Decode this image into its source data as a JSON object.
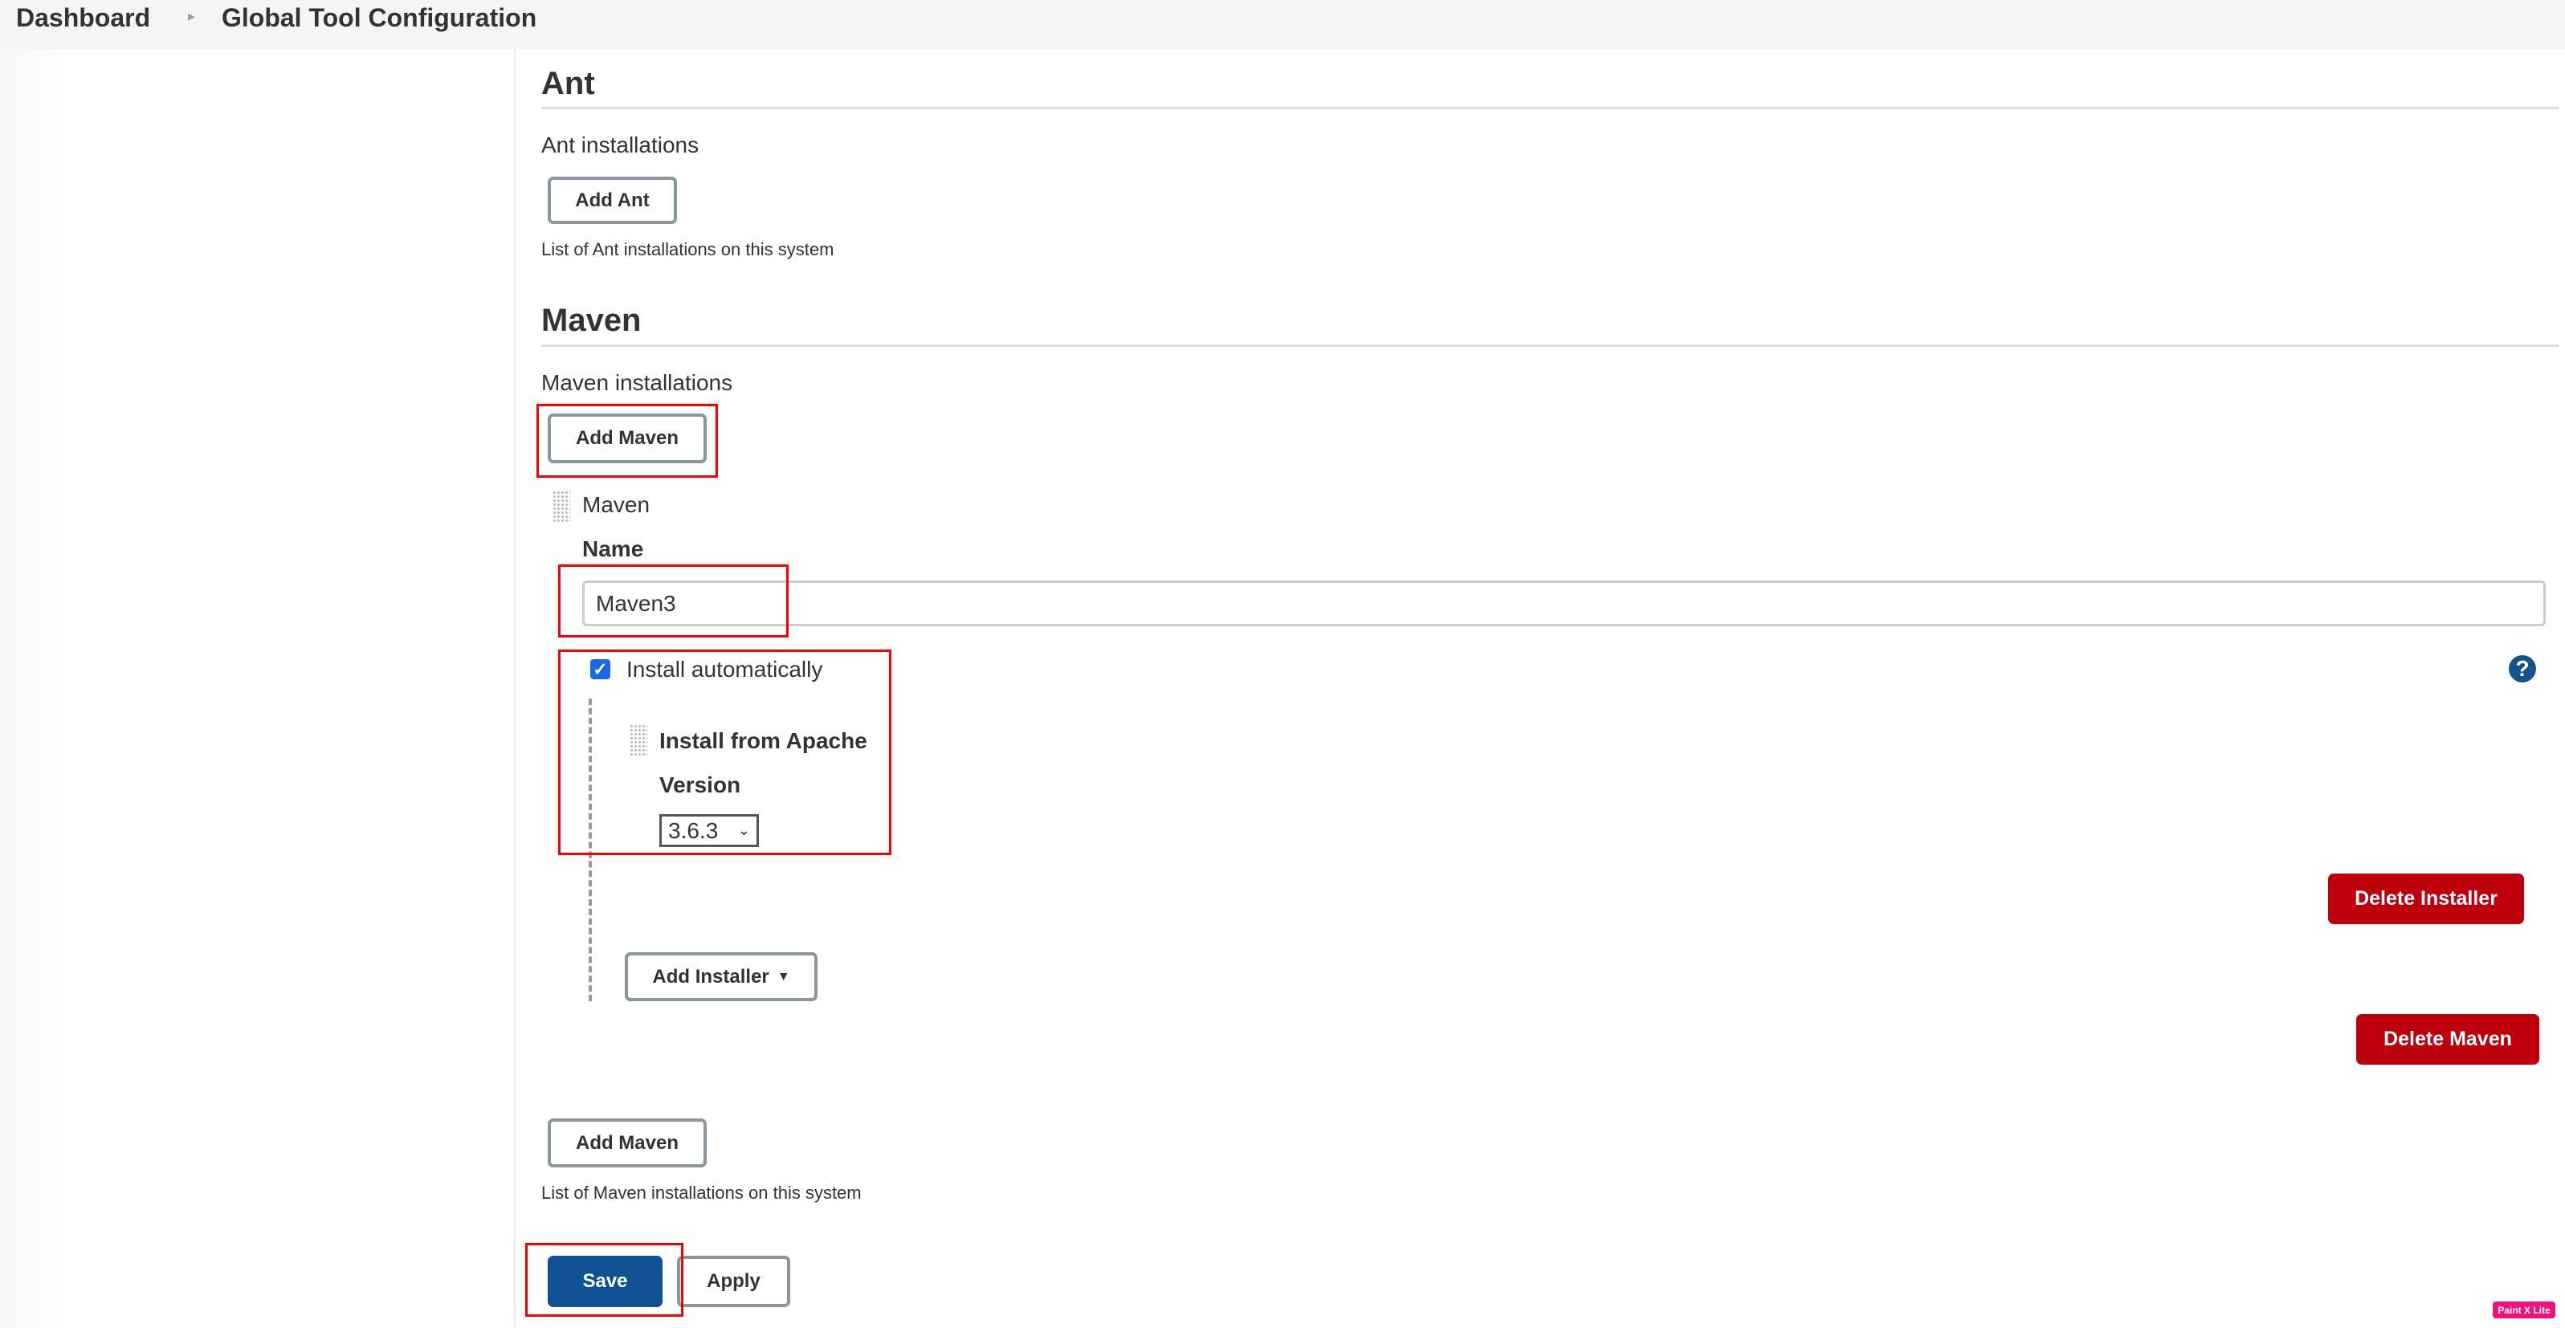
{
  "breadcrumb": {
    "items": [
      "Dashboard",
      "Global Tool Configuration"
    ],
    "separator_icon": "chevron-right-icon"
  },
  "ant": {
    "heading": "Ant",
    "installations_label": "Ant installations",
    "add_button": "Add Ant",
    "description": "List of Ant installations on this system"
  },
  "maven": {
    "heading": "Maven",
    "installations_label": "Maven installations",
    "add_button": "Add Maven",
    "installation": {
      "title": "Maven",
      "name_label": "Name",
      "name_value": "Maven3",
      "install_auto_label": "Install automatically",
      "install_auto_checked": true,
      "installer": {
        "title": "Install from Apache",
        "version_label": "Version",
        "version_value": "3.6.3",
        "delete_button": "Delete Installer"
      },
      "add_installer_button": "Add Installer",
      "delete_button": "Delete Maven"
    },
    "add_button_bottom": "Add Maven",
    "description": "List of Maven installations on this system"
  },
  "footer": {
    "save": "Save",
    "apply": "Apply"
  },
  "watermark": "Paint X Lite",
  "colors": {
    "danger": "#bd000b",
    "primary": "#0f5294",
    "highlight": "#ff0000"
  }
}
